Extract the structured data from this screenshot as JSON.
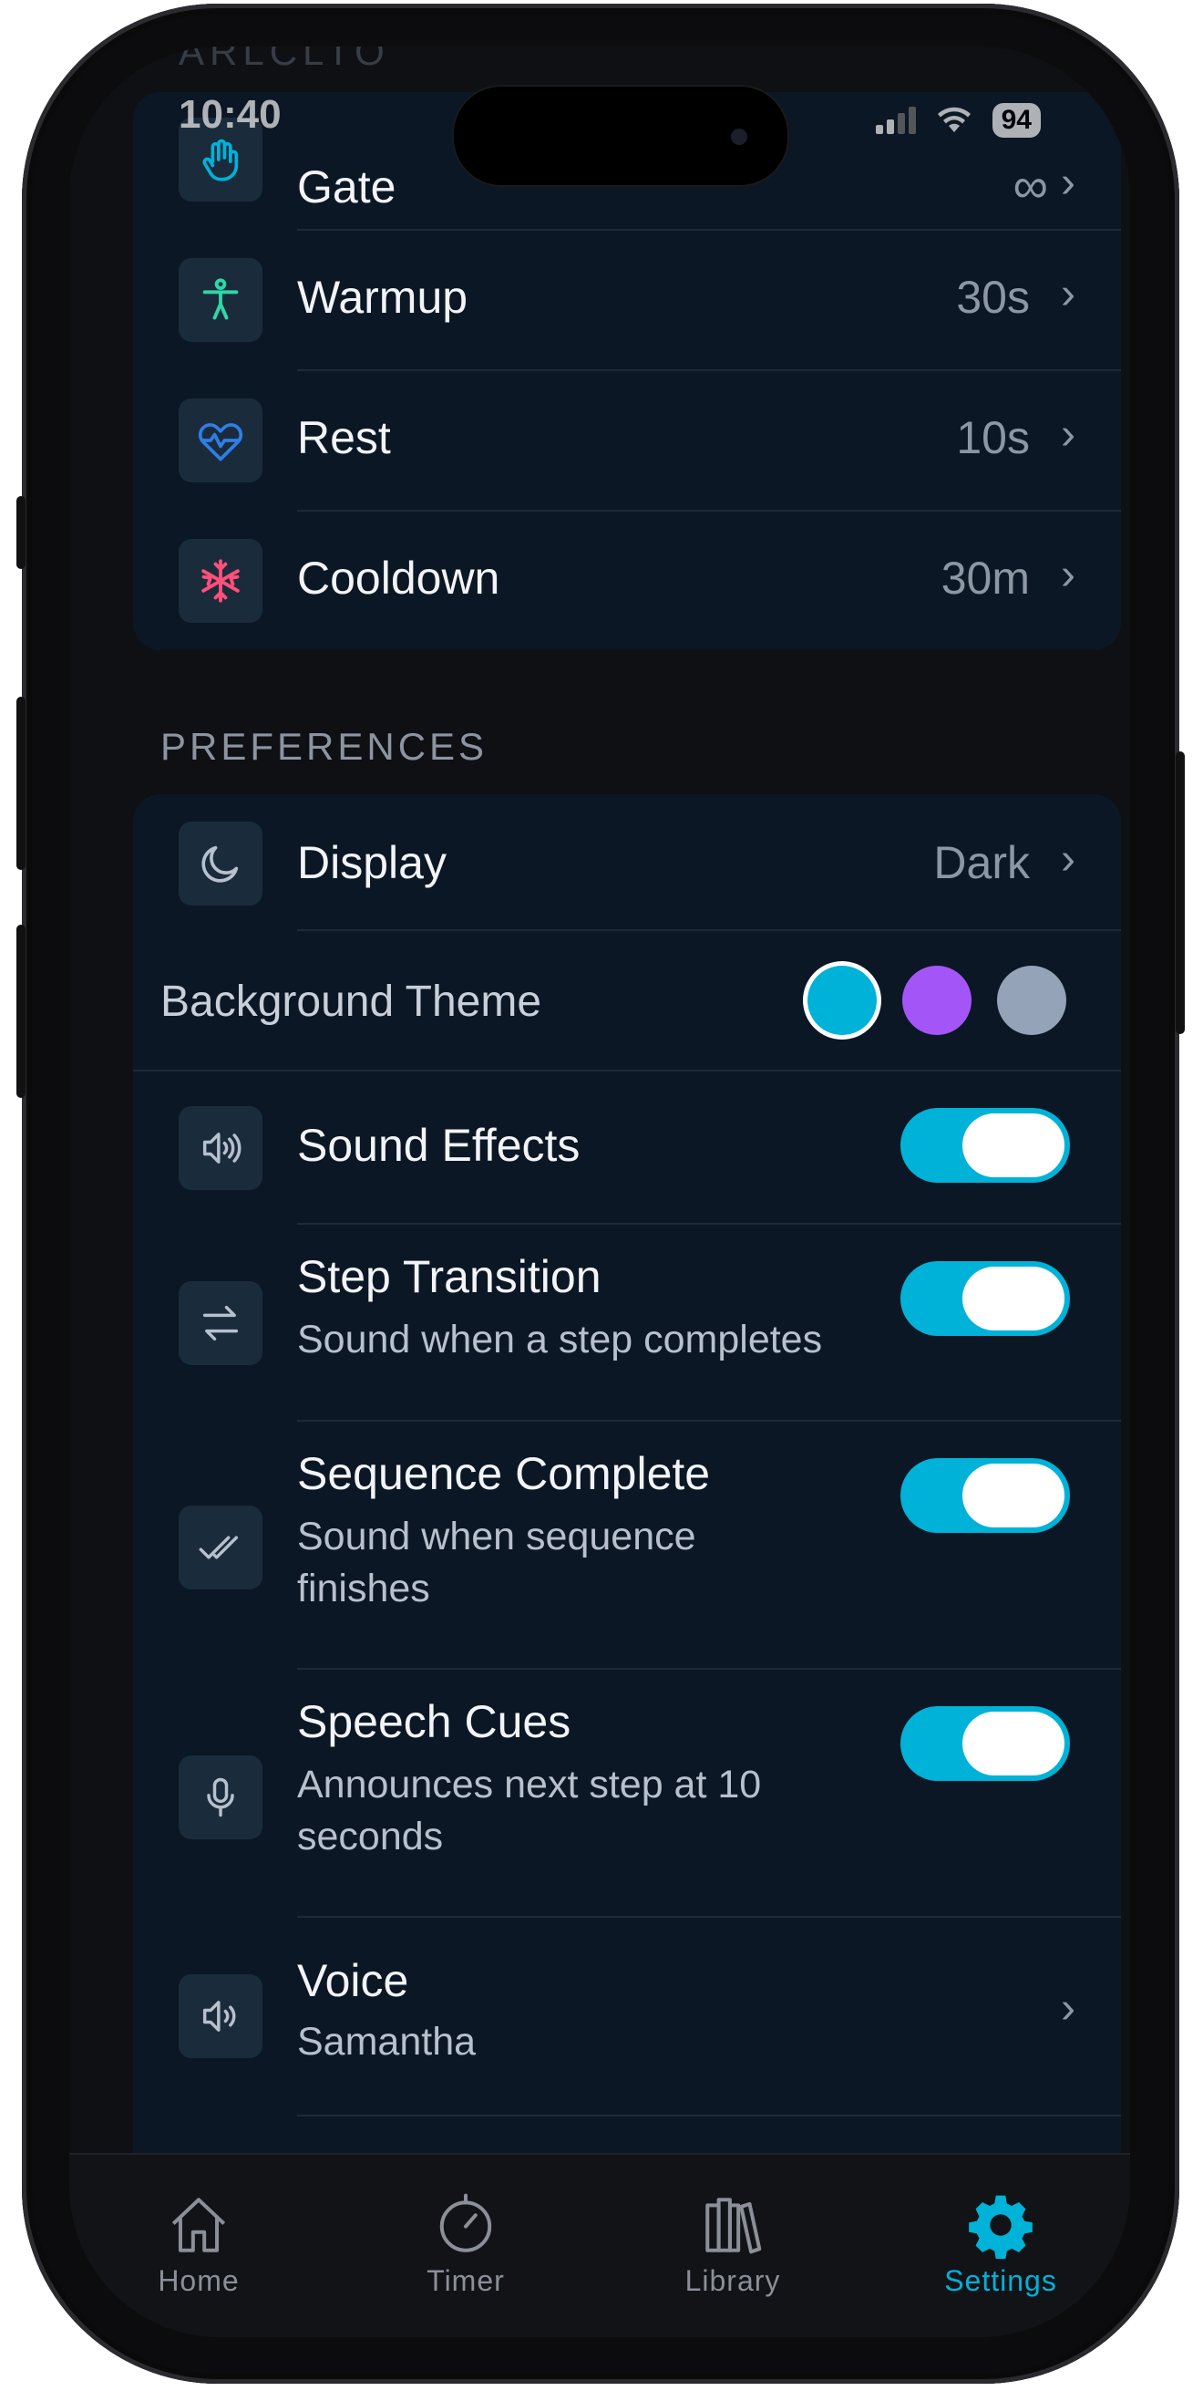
{
  "status_bar": {
    "time": "10:40",
    "battery": "94"
  },
  "ghost_header": "ARLCLTO",
  "sequence_items": [
    {
      "label": "Gate",
      "value": "∞",
      "icon": "raised-hand-icon",
      "icon_color": "#00b2d8"
    },
    {
      "label": "Warmup",
      "value": "30s",
      "icon": "person-stretching-icon",
      "icon_color": "#2ed8a6"
    },
    {
      "label": "Rest",
      "value": "10s",
      "icon": "heartbeat-icon",
      "icon_color": "#2f7ee8"
    },
    {
      "label": "Cooldown",
      "value": "30m",
      "icon": "snowflake-icon",
      "icon_color": "#ff4f7a"
    }
  ],
  "preferences": {
    "section_title": "PREFERENCES",
    "display": {
      "label": "Display",
      "value": "Dark",
      "icon": "moon-icon"
    },
    "background_theme": {
      "label": "Background Theme",
      "swatches": [
        "#00b2d8",
        "#a455f7",
        "#94a3b8"
      ],
      "selected": 0
    },
    "sound_effects": {
      "label": "Sound Effects",
      "on": true,
      "icon": "speaker-icon"
    },
    "step_transition": {
      "label": "Step Transition",
      "subtitle": "Sound when a step completes",
      "on": true,
      "icon": "arrows-exchange-icon"
    },
    "sequence_complete": {
      "label": "Sequence Complete",
      "subtitle_line1": "Sound when sequence",
      "subtitle_line2": "finishes",
      "on": true,
      "icon": "double-check-icon"
    },
    "speech_cues": {
      "label": "Speech Cues",
      "subtitle_line1": "Announces next step at 10",
      "subtitle_line2": "seconds",
      "on": true,
      "icon": "microphone-icon"
    },
    "voice": {
      "label": "Voice",
      "subtitle": "Samantha",
      "icon": "speaker-icon"
    }
  },
  "tab_bar": {
    "active": "settings",
    "active_color": "#00b2d8",
    "inactive_color": "#8a8f98",
    "tabs": [
      {
        "id": "home",
        "label": "Home",
        "icon": "home-icon"
      },
      {
        "id": "timer",
        "label": "Timer",
        "icon": "timer-icon"
      },
      {
        "id": "library",
        "label": "Library",
        "icon": "library-icon"
      },
      {
        "id": "settings",
        "label": "Settings",
        "icon": "gear-icon"
      }
    ]
  },
  "chevron": "›"
}
